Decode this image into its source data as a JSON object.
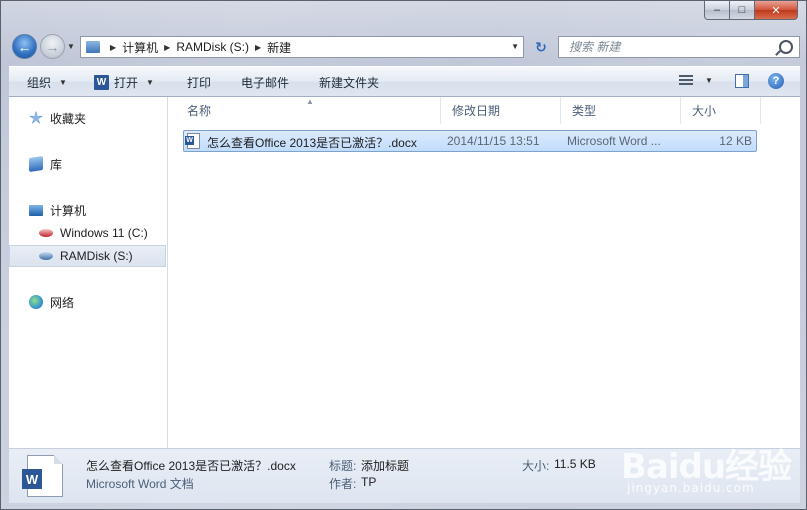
{
  "window": {
    "caption": {
      "minimize": "–",
      "maximize": "□",
      "close": "✕"
    }
  },
  "address": {
    "breadcrumbs": [
      "计算机",
      "RAMDisk (S:)",
      "新建"
    ]
  },
  "search": {
    "placeholder": "搜索 新建"
  },
  "toolbar": {
    "organize": "组织",
    "open": "打开",
    "print": "打印",
    "email": "电子邮件",
    "new_folder": "新建文件夹"
  },
  "nav": {
    "favorites": "收藏夹",
    "libraries": "库",
    "computer": "计算机",
    "drive_c": "Windows 11 (C:)",
    "drive_s": "RAMDisk (S:)",
    "network": "网络"
  },
  "columns": {
    "name": "名称",
    "modified": "修改日期",
    "type": "类型",
    "size": "大小"
  },
  "files": [
    {
      "name": "怎么查看Office 2013是否已激活？.docx",
      "modified": "2014/11/15 13:51",
      "type": "Microsoft Word ...",
      "size": "12 KB"
    }
  ],
  "details": {
    "filename": "怎么查看Office 2013是否已激活？.docx",
    "filetype": "Microsoft Word 文档",
    "title_label": "标题:",
    "title_value": "添加标题",
    "author_label": "作者:",
    "author_value": "TP",
    "size_label": "大小:",
    "size_value": "11.5 KB"
  },
  "watermark": {
    "brand": "Baidu经验",
    "site": "jingyan.baidu.com"
  }
}
